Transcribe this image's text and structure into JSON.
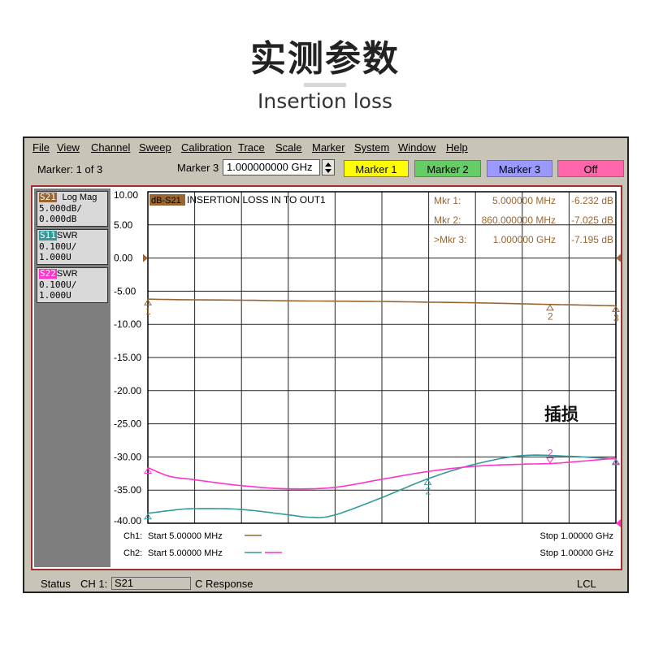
{
  "page": {
    "title": "实测参数",
    "subtitle": "Insertion loss",
    "annotation": "插损"
  },
  "menubar": {
    "items": [
      "File",
      "View",
      "Channel",
      "Sweep",
      "Calibration",
      "Trace",
      "Scale",
      "Marker",
      "System",
      "Window",
      "Help"
    ]
  },
  "toolbar": {
    "marker_count": "Marker: 1 of 3",
    "marker_select_label": "Marker 3",
    "marker_value": "1.000000000 GHz",
    "buttons": [
      {
        "label": "Marker 1",
        "color": "#ffff00"
      },
      {
        "label": "Marker 2",
        "color": "#66cc66"
      },
      {
        "label": "Marker 3",
        "color": "#9999ff"
      },
      {
        "label": "Off",
        "color": "#ff66aa"
      }
    ]
  },
  "traces": [
    {
      "tag": "S21",
      "type": "Log Mag",
      "scale": "5.000dB/",
      "ref": "0.000dB",
      "color": "#996633"
    },
    {
      "tag": "S11",
      "type": "SWR",
      "scale": "0.100U/",
      "ref": "1.000U",
      "color": "#339999"
    },
    {
      "tag": "S22",
      "type": "SWR",
      "scale": "0.100U/",
      "ref": "1.000U",
      "color": "#ff33cc"
    }
  ],
  "plot": {
    "trace_tag": "dB-S21",
    "title": "INSERTION LOSS IN TO OUT1",
    "markers": [
      {
        "label": "Mkr  1:",
        "freq": "5.000000 MHz",
        "value": "-6.232 dB"
      },
      {
        "label": "Mkr  2:",
        "freq": "860.000000 MHz",
        "value": "-7.025 dB"
      },
      {
        "label": ">Mkr  3:",
        "freq": "1.000000 GHz",
        "value": "-7.195 dB"
      }
    ],
    "ch1": {
      "label": "Ch1:",
      "start": "Start  5.00000 MHz",
      "stop": "Stop   1.00000 GHz"
    },
    "ch2": {
      "label": "Ch2:",
      "start": "Start  5.00000 MHz",
      "stop": "Stop   1.00000 GHz"
    }
  },
  "status": {
    "label": "Status",
    "channel": "CH 1:",
    "field": "S21",
    "mode": "C  Response",
    "lcl": "LCL"
  },
  "chart_data": {
    "type": "line",
    "x_unit": "MHz",
    "xlim": [
      5,
      1000
    ],
    "ylim": [
      -40,
      10
    ],
    "y_ticks": [
      "10.00",
      "5.00",
      "0.00",
      "-5.00",
      "-10.00",
      "-15.00",
      "-20.00",
      "-25.00",
      "-30.00",
      "-35.00",
      "-40.00"
    ],
    "reference_level": 0,
    "grid": true,
    "series": [
      {
        "name": "S21",
        "color": "#996633",
        "x": [
          5,
          100,
          200,
          300,
          400,
          500,
          600,
          700,
          800,
          860,
          900,
          1000
        ],
        "y": [
          -6.2,
          -6.3,
          -6.35,
          -6.45,
          -6.5,
          -6.55,
          -6.65,
          -6.75,
          -6.9,
          -7.0,
          -7.05,
          -7.2
        ]
      },
      {
        "name": "S11",
        "color": "#339999",
        "x": [
          5,
          50,
          100,
          200,
          300,
          350,
          400,
          500,
          600,
          700,
          800,
          900,
          1000
        ],
        "y": [
          -38.5,
          -38.1,
          -37.8,
          -37.9,
          -38.7,
          -39.1,
          -38.8,
          -36.2,
          -33.3,
          -31.1,
          -29.8,
          -29.9,
          -30.3
        ]
      },
      {
        "name": "S22",
        "color": "#ff33cc",
        "x": [
          5,
          50,
          100,
          200,
          300,
          400,
          500,
          600,
          700,
          800,
          860,
          900,
          1000
        ],
        "y": [
          -31.6,
          -32.9,
          -33.4,
          -34.3,
          -34.8,
          -34.6,
          -33.4,
          -32.2,
          -31.4,
          -31.1,
          -31.0,
          -30.8,
          -30.2
        ]
      }
    ]
  }
}
